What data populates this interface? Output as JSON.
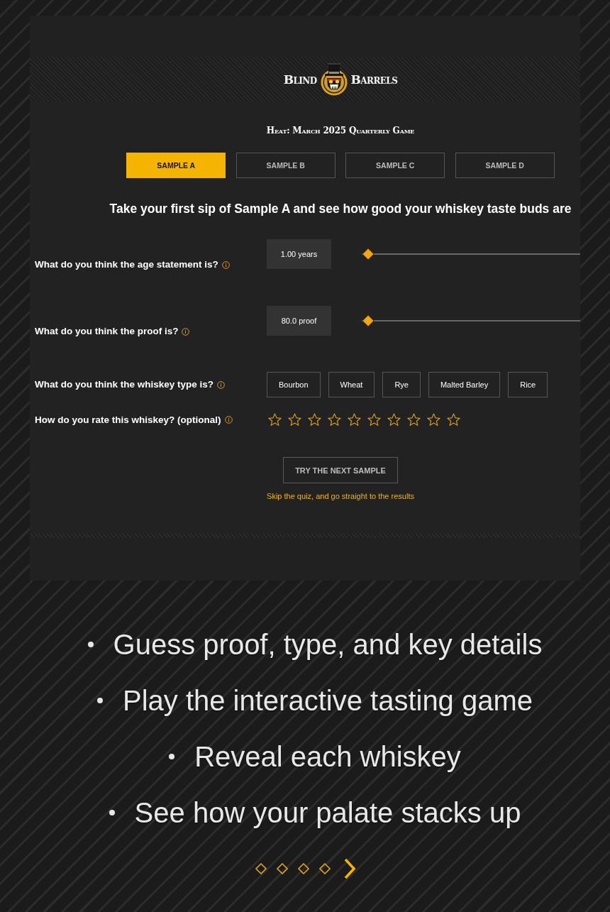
{
  "logo": {
    "left_word": "Blind",
    "right_word": "Barrels"
  },
  "heading": "Heat: March 2025 Quarterly Game",
  "tabs": [
    {
      "label": "SAMPLE A",
      "selected": true
    },
    {
      "label": "SAMPLE B",
      "selected": false
    },
    {
      "label": "SAMPLE C",
      "selected": false
    },
    {
      "label": "SAMPLE D",
      "selected": false
    }
  ],
  "intro": "Take your first sip of Sample A and see how good your whiskey taste buds are",
  "questions": [
    {
      "kind": "slider",
      "label": "What do you think the age statement is?",
      "value": "1.00 years",
      "level": 0
    },
    {
      "kind": "slider",
      "label": "What do you think the proof is?",
      "value": "80.0 proof",
      "level": 0
    },
    {
      "kind": "choice",
      "label": "What do you think the whiskey type is?",
      "options": [
        {
          "label": "Bourbon",
          "selected": false
        },
        {
          "label": "Wheat",
          "selected": false
        },
        {
          "label": "Rye",
          "selected": false
        },
        {
          "label": "Malted Barley",
          "selected": false
        },
        {
          "label": "Rice",
          "selected": false
        }
      ]
    },
    {
      "kind": "rating",
      "label": "How do you rate this whiskey? (optional)",
      "stars": 0
    }
  ],
  "next_button": "TRY THE NEXT SAMPLE",
  "skip_link": "Skip the quiz, and go straight to the results",
  "bullets": [
    "Guess proof, type, and key details",
    "Play the interactive tasting game",
    "Reveal each whiskey",
    "See how your palate stacks up"
  ],
  "pager": {
    "dots": [
      {
        "selected": false
      },
      {
        "selected": false
      },
      {
        "selected": false
      },
      {
        "selected": false
      }
    ]
  }
}
